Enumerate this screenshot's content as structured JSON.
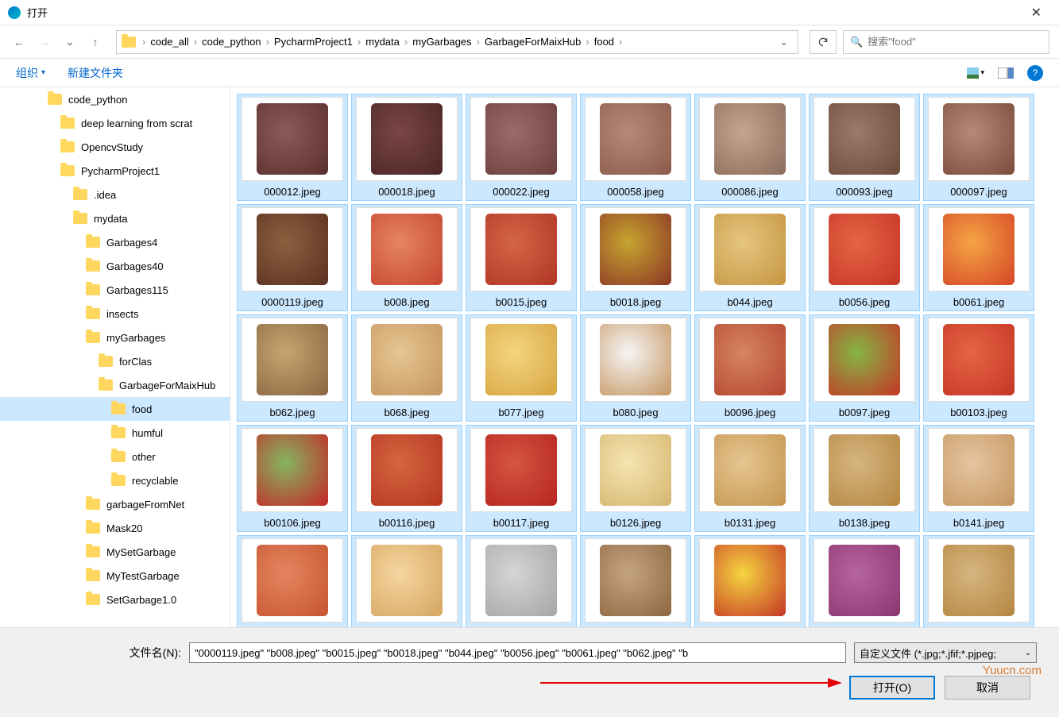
{
  "window": {
    "title": "打开"
  },
  "nav": {
    "breadcrumbs": [
      "code_all",
      "code_python",
      "PycharmProject1",
      "mydata",
      "myGarbages",
      "GarbageForMaixHub",
      "food"
    ],
    "search_placeholder": "搜索\"food\""
  },
  "toolbar": {
    "organize": "组织",
    "new_folder": "新建文件夹"
  },
  "tree": [
    {
      "label": "code_python",
      "indent": 60,
      "selected": false
    },
    {
      "label": "deep learning from scrat",
      "indent": 76,
      "selected": false
    },
    {
      "label": "OpencvStudy",
      "indent": 76,
      "selected": false
    },
    {
      "label": "PycharmProject1",
      "indent": 76,
      "selected": false
    },
    {
      "label": ".idea",
      "indent": 92,
      "selected": false
    },
    {
      "label": "mydata",
      "indent": 92,
      "selected": false
    },
    {
      "label": "Garbages4",
      "indent": 108,
      "selected": false
    },
    {
      "label": "Garbages40",
      "indent": 108,
      "selected": false
    },
    {
      "label": "Garbages115",
      "indent": 108,
      "selected": false
    },
    {
      "label": "insects",
      "indent": 108,
      "selected": false
    },
    {
      "label": "myGarbages",
      "indent": 108,
      "selected": false
    },
    {
      "label": "forClas",
      "indent": 124,
      "selected": false
    },
    {
      "label": "GarbageForMaixHub",
      "indent": 124,
      "selected": false
    },
    {
      "label": "food",
      "indent": 140,
      "selected": true
    },
    {
      "label": "humful",
      "indent": 140,
      "selected": false
    },
    {
      "label": "other",
      "indent": 140,
      "selected": false
    },
    {
      "label": "recyclable",
      "indent": 140,
      "selected": false
    },
    {
      "label": "garbageFromNet",
      "indent": 108,
      "selected": false
    },
    {
      "label": "Mask20",
      "indent": 108,
      "selected": false
    },
    {
      "label": "MySetGarbage",
      "indent": 108,
      "selected": false
    },
    {
      "label": "MyTestGarbage",
      "indent": 108,
      "selected": false
    },
    {
      "label": "SetGarbage1.0",
      "indent": 108,
      "selected": false
    }
  ],
  "files": [
    {
      "name": "000012.jpeg",
      "selected": true,
      "c1": "#5a2e2e",
      "c2": "#8b5a5a"
    },
    {
      "name": "000018.jpeg",
      "selected": true,
      "c1": "#4a2525",
      "c2": "#7a4545"
    },
    {
      "name": "000022.jpeg",
      "selected": true,
      "c1": "#6b3e3e",
      "c2": "#9b6b6b"
    },
    {
      "name": "000058.jpeg",
      "selected": true,
      "c1": "#8b5a4a",
      "c2": "#b58a7a"
    },
    {
      "name": "000086.jpeg",
      "selected": true,
      "c1": "#8b6b5a",
      "c2": "#c5a590"
    },
    {
      "name": "000093.jpeg",
      "selected": true,
      "c1": "#6b4a3a",
      "c2": "#9b7a6a"
    },
    {
      "name": "000097.jpeg",
      "selected": true,
      "c1": "#7a4a3a",
      "c2": "#b58a7a"
    },
    {
      "name": "0000119.jpeg",
      "selected": true,
      "c1": "#5a3020",
      "c2": "#8b6040"
    },
    {
      "name": "b008.jpeg",
      "selected": true,
      "c1": "#c54530",
      "c2": "#e58560"
    },
    {
      "name": "b0015.jpeg",
      "selected": true,
      "c1": "#b03525",
      "c2": "#d56545"
    },
    {
      "name": "b0018.jpeg",
      "selected": true,
      "c1": "#8b3525",
      "c2": "#c5a530"
    },
    {
      "name": "b044.jpeg",
      "selected": true,
      "c1": "#c59540",
      "c2": "#e5c580"
    },
    {
      "name": "b0056.jpeg",
      "selected": true,
      "c1": "#c53525",
      "c2": "#e56545"
    },
    {
      "name": "b0061.jpeg",
      "selected": true,
      "c1": "#d54525",
      "c2": "#f5a545"
    },
    {
      "name": "b062.jpeg",
      "selected": true,
      "c1": "#8b6540",
      "c2": "#c5a570"
    },
    {
      "name": "b068.jpeg",
      "selected": true,
      "c1": "#c59560",
      "c2": "#e5c590"
    },
    {
      "name": "b077.jpeg",
      "selected": true,
      "c1": "#d5a540",
      "c2": "#f5d580"
    },
    {
      "name": "b080.jpeg",
      "selected": true,
      "c1": "#c59560",
      "c2": "#f5f5f5"
    },
    {
      "name": "b0096.jpeg",
      "selected": true,
      "c1": "#b54530",
      "c2": "#d58560"
    },
    {
      "name": "b0097.jpeg",
      "selected": true,
      "c1": "#c53525",
      "c2": "#85b545"
    },
    {
      "name": "b00103.jpeg",
      "selected": true,
      "c1": "#c53525",
      "c2": "#e56545"
    },
    {
      "name": "b00106.jpeg",
      "selected": true,
      "c1": "#c52525",
      "c2": "#85b560"
    },
    {
      "name": "b00116.jpeg",
      "selected": true,
      "c1": "#b53520",
      "c2": "#d56540"
    },
    {
      "name": "b00117.jpeg",
      "selected": true,
      "c1": "#b52520",
      "c2": "#d55540"
    },
    {
      "name": "b0126.jpeg",
      "selected": true,
      "c1": "#d5b570",
      "c2": "#f5e5b0"
    },
    {
      "name": "b0131.jpeg",
      "selected": true,
      "c1": "#c59550",
      "c2": "#e5c590"
    },
    {
      "name": "b0138.jpeg",
      "selected": true,
      "c1": "#b58540",
      "c2": "#d5b580"
    },
    {
      "name": "b0141.jpeg",
      "selected": true,
      "c1": "#c59560",
      "c2": "#e5c5a0"
    },
    {
      "name": "",
      "selected": true,
      "c1": "#c55530",
      "c2": "#e58560"
    },
    {
      "name": "",
      "selected": true,
      "c1": "#d5a560",
      "c2": "#f5d5a0"
    },
    {
      "name": "",
      "selected": true,
      "c1": "#a5a5a5",
      "c2": "#d5d5d5"
    },
    {
      "name": "",
      "selected": true,
      "c1": "#8b6540",
      "c2": "#c5a580"
    },
    {
      "name": "",
      "selected": true,
      "c1": "#c53525",
      "c2": "#f5d540"
    },
    {
      "name": "",
      "selected": true,
      "c1": "#8b3570",
      "c2": "#b565a0"
    },
    {
      "name": "",
      "selected": true,
      "c1": "#b58540",
      "c2": "#d5b580"
    }
  ],
  "footer": {
    "filename_label": "文件名(N):",
    "filename_value": "\"0000119.jpeg\" \"b008.jpeg\" \"b0015.jpeg\" \"b0018.jpeg\" \"b044.jpeg\" \"b0056.jpeg\" \"b0061.jpeg\" \"b062.jpeg\" \"b",
    "filetype": "自定义文件 (*.jpg;*.jfif;*.pjpeg;",
    "open": "打开(O)",
    "cancel": "取消"
  },
  "watermark": "Yuucn.com"
}
